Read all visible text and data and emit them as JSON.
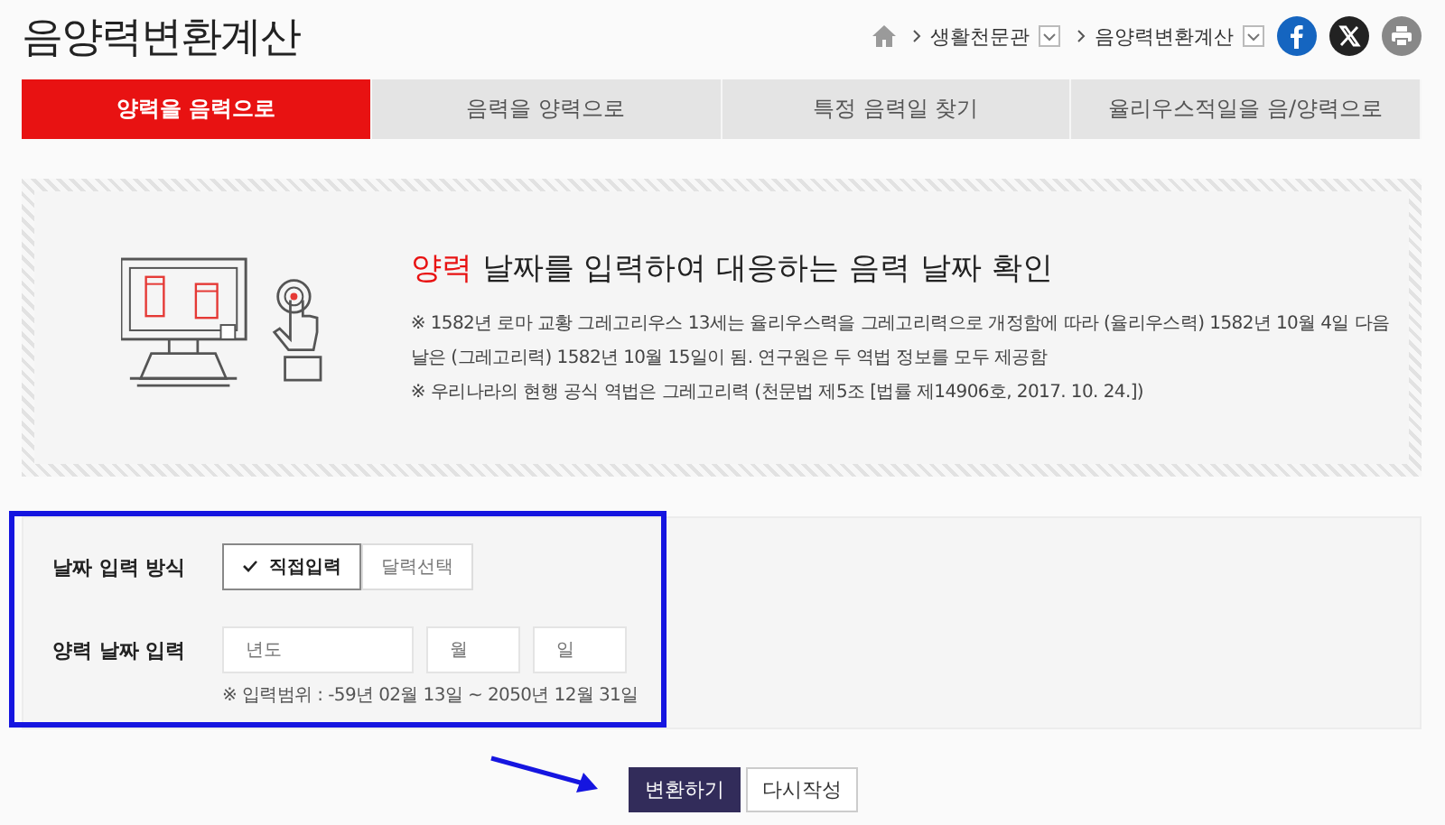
{
  "page_title": "음양력변환계산",
  "breadcrumb": [
    {
      "label": "생활천문관"
    },
    {
      "label": "음양력변환계산"
    }
  ],
  "tabs": [
    {
      "label": "양력을 음력으로",
      "selected": true
    },
    {
      "label": "음력을 양력으로",
      "selected": false
    },
    {
      "label": "특정 음력일 찾기",
      "selected": false
    },
    {
      "label": "율리우스적일을 음/양력으로",
      "selected": false
    }
  ],
  "info": {
    "heading_highlight": "양력",
    "heading_rest": " 날짜를 입력하여 대응하는 음력 날짜 확인",
    "notes": [
      "※ 1582년 로마 교황 그레고리우스 13세는 율리우스력을 그레고리력으로 개정함에 따라 (율리우스력) 1582년 10월 4일 다음 날은 (그레고리력) 1582년 10월 15일이 됨. 연구원은 두 역법 정보를 모두 제공함",
      "※ 우리나라의 현행 공식 역법은 그레고리력 (천문법 제5조 [법률 제14906호, 2017. 10. 24.])"
    ]
  },
  "form": {
    "method_label": "날짜 입력 방식",
    "methods": [
      {
        "label": "직접입력",
        "selected": true
      },
      {
        "label": "달력선택",
        "selected": false
      }
    ],
    "date_label": "양력 날짜 입력",
    "fields": [
      {
        "placeholder": "년도"
      },
      {
        "placeholder": "월"
      },
      {
        "placeholder": "일"
      }
    ],
    "range_note": "※ 입력범위 : -59년 02월 13일 ~ 2050년 12월 31일"
  },
  "buttons": [
    {
      "label": "변환하기",
      "kind": "primary"
    },
    {
      "label": "다시작성",
      "kind": "secondary"
    }
  ]
}
